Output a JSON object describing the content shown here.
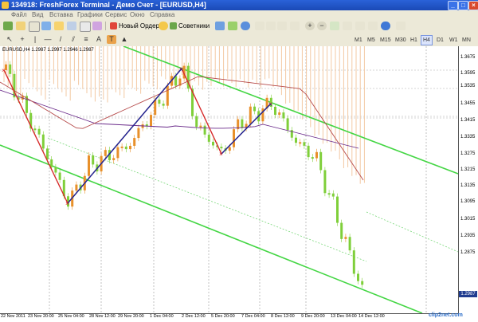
{
  "window": {
    "title": "134918: FreshForex Terminal - Демо Счет - [EURUSD,H4]",
    "controls": [
      "_",
      "□",
      "×"
    ]
  },
  "menu": [
    "Файл",
    "Вид",
    "Вставка",
    "Графики",
    "Сервис",
    "Окно",
    "Справка"
  ],
  "toolbar": {
    "new_order": "Новый Ордер",
    "experts": "Советники"
  },
  "timeframes": [
    "M1",
    "M5",
    "M15",
    "M30",
    "H1",
    "H4",
    "D1",
    "W1",
    "MN"
  ],
  "active_timeframe": "H4",
  "chart": {
    "symbol_info": "EURUSD,H4  1.2987 1.2997 1.2946 1.2987",
    "current_price": "1.2987",
    "price_labels": [
      "1.3675",
      "1.3595",
      "1.3535",
      "1.3455",
      "1.3415",
      "1.3335",
      "1.3275",
      "1.3215",
      "1.3135",
      "1.3095",
      "1.3015",
      "1.2935",
      "1.2875"
    ],
    "time_labels": [
      "22 Nov 2011",
      "23 Nov 20:00",
      "25 Nov 04:00",
      "28 Nov 12:00",
      "29 Nov 20:00",
      "1 Dec 04:00",
      "2 Dec 12:00",
      "5 Dec 20:00",
      "7 Dec 04:00",
      "8 Dec 12:00",
      "9 Dec 20:00",
      "13 Dec 04:00",
      "14 Dec 12:00"
    ],
    "colors": {
      "up": "#e8902a",
      "down": "#7fcf3a",
      "channel": "#44d644",
      "zigzag": "#d62a2a",
      "waves": "#1a2a9b",
      "ma": "#6a2a8a"
    }
  },
  "watermark": "clip2net.com"
}
